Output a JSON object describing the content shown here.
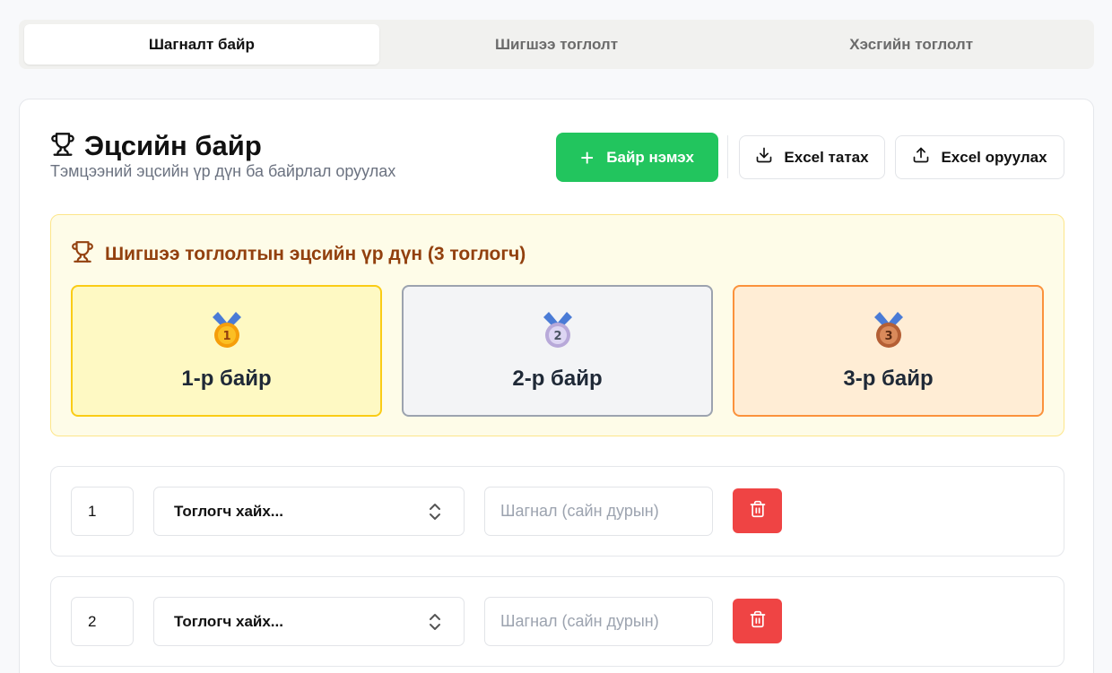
{
  "tabs": [
    {
      "label": "Шагналт байр",
      "active": true
    },
    {
      "label": "Шигшээ тоглолт",
      "active": false
    },
    {
      "label": "Хэсгийн тоглолт",
      "active": false
    }
  ],
  "header": {
    "title": "Эцсийн байр",
    "subtitle": "Тэмцээний эцсийн үр дүн ба байрлал оруулах",
    "add_label": "Байр нэмэх",
    "download_label": "Excel татах",
    "upload_label": "Excel оруулах"
  },
  "results": {
    "title": "Шигшээ тоглолтын эцсийн үр дүн (3 тоглогч)",
    "places": [
      {
        "label": "1-р байр",
        "medal": "1"
      },
      {
        "label": "2-р байр",
        "medal": "2"
      },
      {
        "label": "3-р байр",
        "medal": "3"
      }
    ]
  },
  "entries": [
    {
      "rank": "1",
      "player_placeholder": "Тоглогч хайх...",
      "prize_placeholder": "Шагнал (сайн дурын)"
    },
    {
      "rank": "2",
      "player_placeholder": "Тоглогч хайх...",
      "prize_placeholder": "Шагнал (сайн дурын)"
    }
  ],
  "colors": {
    "accent_green": "#22c55e",
    "danger_red": "#ef4444",
    "gold": "#facc15",
    "silver": "#9ca3af",
    "bronze": "#fb923c"
  }
}
